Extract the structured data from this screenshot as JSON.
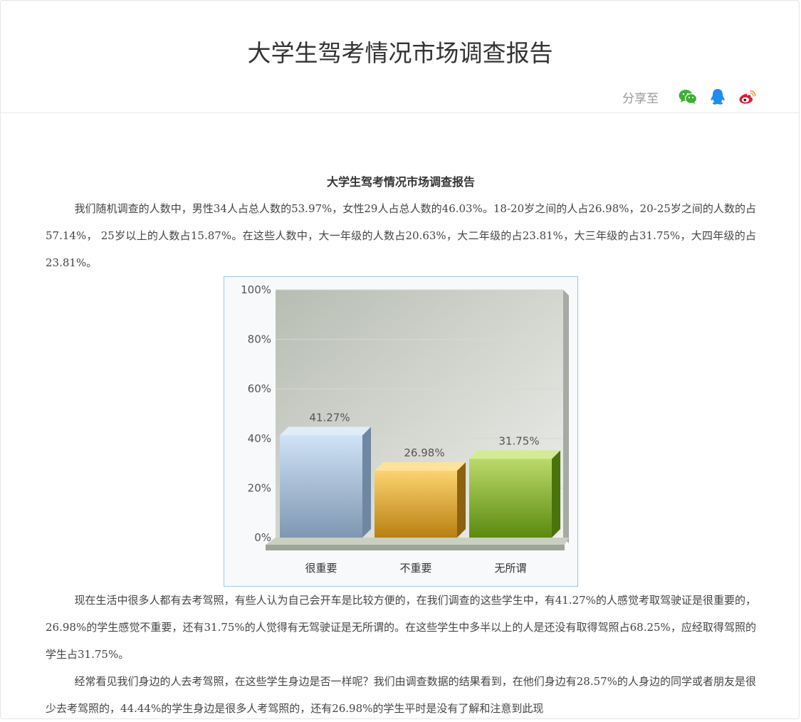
{
  "header": {
    "title": "大学生驾考情况市场调查报告",
    "share_label": "分享至",
    "share_icons": [
      "wechat-icon",
      "qq-icon",
      "weibo-icon"
    ],
    "colors": {
      "wechat": "#3cb034",
      "qq": "#1e8cf0",
      "weibo": "#e6162d"
    }
  },
  "article": {
    "title": "大学生驾考情况市场调查报告",
    "paragraphs": [
      "我们随机调查的人数中，男性34人占总人数的53.97%，女性29人占总人数的46.03%。18-20岁之间的人占26.98%，20-25岁之间的人数的占57.14%， 25岁以上的人数占15.87%。在这些人数中，大一年级的人数占20.63%，大二年级的占23.81%，大三年级的占31.75%，大四年级的占23.81%。",
      "现在生活中很多人都有去考驾照，有些人认为自己会开车是比较方便的，在我们调查的这些学生中，有41.27%的人感觉考取驾驶证是很重要的，26.98%的学生感觉不重要，还有31.75%的人觉得有无驾驶证是无所谓的。在这些学生中多半以上的人是还没有取得驾照占68.25%，应经取得驾照的学生占31.75%。",
      "经常看见我们身边的人去考驾照，在这些学生身边是否一样呢？我们由调查数据的结果看到，在他们身边有28.57%的人身边的同学或者朋友是很少去考驾照的，44.44%的学生身边是很多人考驾照的，还有26.98%的学生平时是没有了解和注意到此现"
    ]
  },
  "chart_data": {
    "type": "bar",
    "categories": [
      "很重要",
      "不重要",
      "无所谓"
    ],
    "values": [
      41.27,
      26.98,
      31.75
    ],
    "value_labels": [
      "41.27%",
      "26.98%",
      "31.75%"
    ],
    "yticks": [
      "0%",
      "20%",
      "40%",
      "60%",
      "80%",
      "100%"
    ],
    "ylim": [
      0,
      100
    ],
    "grid": true,
    "colors": [
      "#a9c3dc",
      "#e8b43a",
      "#7fae2a"
    ]
  }
}
